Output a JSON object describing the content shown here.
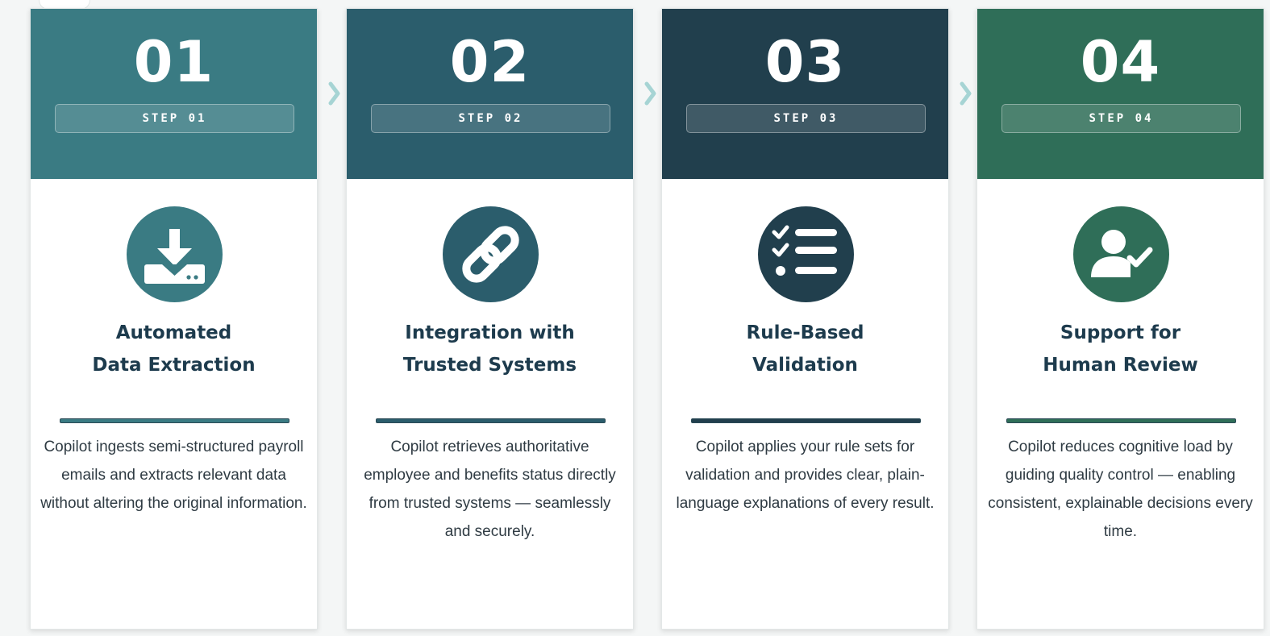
{
  "colors": {
    "step1": "#3a7b83",
    "step2": "#2b5d6c",
    "step3": "#213f4d",
    "step4": "#2f6e58",
    "title_text": "#1d3b4d",
    "body_text": "#2f3b43",
    "arrow": "#a6d4d4"
  },
  "steps": [
    {
      "number": "01",
      "step_label": "STEP 01",
      "icon": "download-tray-icon",
      "title_line1": "Automated",
      "title_line2": "Data Extraction",
      "description": "Copilot ingests semi-structured payroll emails and extracts relevant data without altering the original information."
    },
    {
      "number": "02",
      "step_label": "STEP 02",
      "icon": "link-icon",
      "title_line1": "Integration with",
      "title_line2": "Trusted Systems",
      "description": "Copilot retrieves authoritative employee and benefits status directly from trusted systems — seamlessly and securely."
    },
    {
      "number": "03",
      "step_label": "STEP 03",
      "icon": "checklist-icon",
      "title_line1": "Rule-Based",
      "title_line2": "Validation",
      "description": "Copilot applies your rule sets for validation and provides clear, plain-language explanations of every result."
    },
    {
      "number": "04",
      "step_label": "STEP 04",
      "icon": "user-check-icon",
      "title_line1": "Support for",
      "title_line2": "Human Review",
      "description": "Copilot reduces cognitive load by guiding quality control — enabling consistent, explainable decisions every time."
    }
  ]
}
